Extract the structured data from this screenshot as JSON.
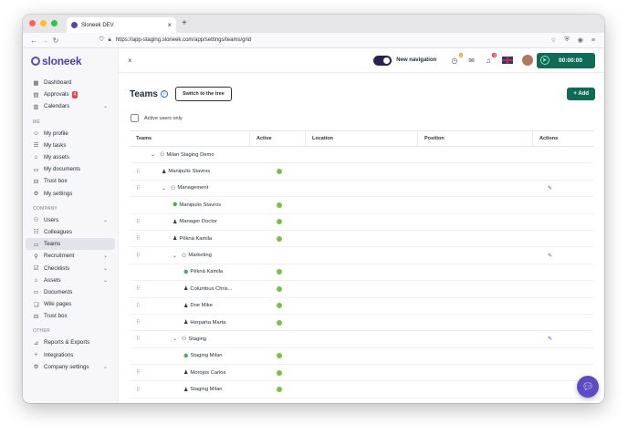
{
  "browser": {
    "tab_title": "Sloneek DEV",
    "url": "https://app-staging.sloneek.com/app/settings/teams/grid",
    "colors": {
      "close": "#ff5f57",
      "min": "#febc2e",
      "max": "#28c840"
    }
  },
  "sidebar": {
    "logo": "sloneek",
    "top": [
      {
        "label": "Dashboard",
        "icon": "grid-icon"
      },
      {
        "label": "Approvals",
        "icon": "check-doc-icon",
        "badge": "4"
      },
      {
        "label": "Calendars",
        "icon": "calendar-icon",
        "chevron": true
      }
    ],
    "me_label": "ME",
    "me": [
      {
        "label": "My profile"
      },
      {
        "label": "My tasks"
      },
      {
        "label": "My assets"
      },
      {
        "label": "My documents"
      },
      {
        "label": "Trust box"
      },
      {
        "label": "My settings"
      }
    ],
    "company_label": "COMPANY",
    "company": [
      {
        "label": "Users",
        "chevron": true
      },
      {
        "label": "Colleagues"
      },
      {
        "label": "Teams",
        "active": true
      },
      {
        "label": "Recruitment",
        "chevron": true
      },
      {
        "label": "Checklists",
        "chevron": true
      },
      {
        "label": "Assets",
        "chevron": true
      },
      {
        "label": "Documents"
      },
      {
        "label": "Wiki pages"
      },
      {
        "label": "Trust box"
      }
    ],
    "other_label": "OTHER",
    "other": [
      {
        "label": "Reports & Exports"
      },
      {
        "label": "Integrations"
      },
      {
        "label": "Company settings",
        "chevron": true
      }
    ]
  },
  "topbar": {
    "toggle_label": "New navigation",
    "notif_badge_1": "1",
    "notif_badge_2": "3",
    "timer": "00:00:00"
  },
  "page": {
    "title": "Teams",
    "switch_button": "Switch to the tree",
    "add_button": "+ Add",
    "filter_label": "Active users only"
  },
  "table": {
    "headers": {
      "teams": "Teams",
      "active": "Active",
      "location": "Location",
      "position": "Position",
      "actions": "Actions"
    },
    "rows": [
      {
        "name": "Milan Staging Demo",
        "type": "team",
        "level": 0,
        "caret": true,
        "grip": false,
        "active": false,
        "edit": false
      },
      {
        "name": "Manipulis Stavros",
        "type": "user",
        "level": 1,
        "grip": true,
        "active": true
      },
      {
        "name": "Management",
        "type": "team",
        "level": 1,
        "caret": true,
        "grip": true,
        "active": false,
        "edit": true
      },
      {
        "name": "Manipulis Stavros",
        "type": "lead",
        "level": 2,
        "grip": false,
        "active": true
      },
      {
        "name": "Manager Doctor",
        "type": "user",
        "level": 2,
        "grip": true,
        "active": true
      },
      {
        "name": "Pěkná Kamila",
        "type": "user",
        "level": 2,
        "grip": true,
        "active": true
      },
      {
        "name": "Marketing",
        "type": "team",
        "level": 2,
        "caret": true,
        "grip": true,
        "active": false,
        "edit": true
      },
      {
        "name": "Pěkná Kamila",
        "type": "lead",
        "level": 3,
        "grip": false,
        "active": true
      },
      {
        "name": "Columbus Chris...",
        "type": "user",
        "level": 3,
        "grip": true,
        "active": true
      },
      {
        "name": "Doe Mike",
        "type": "user",
        "level": 3,
        "grip": true,
        "active": true
      },
      {
        "name": "Herparta Marta",
        "type": "user",
        "level": 3,
        "grip": true,
        "active": true
      },
      {
        "name": "Staging",
        "type": "team",
        "level": 2,
        "caret": true,
        "grip": true,
        "active": false,
        "edit": true
      },
      {
        "name": "Staging Milan",
        "type": "lead",
        "level": 3,
        "grip": false,
        "active": true
      },
      {
        "name": "Morojos Carlos",
        "type": "user",
        "level": 3,
        "grip": true,
        "active": true
      },
      {
        "name": "Staging Milan",
        "type": "user",
        "level": 3,
        "grip": true,
        "active": true
      }
    ]
  }
}
